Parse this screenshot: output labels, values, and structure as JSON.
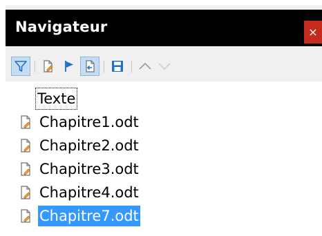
{
  "window": {
    "title": "Navigateur",
    "close_glyph": "×"
  },
  "toolbar": {
    "buttons": [
      {
        "icon": "filter-icon",
        "active": true
      },
      {
        "icon": "edit-document-icon",
        "active": false
      },
      {
        "icon": "flag-icon",
        "active": false
      },
      {
        "icon": "insert-document-icon",
        "active": true
      },
      {
        "icon": "save-icon",
        "active": false
      },
      {
        "icon": "chevron-up-icon",
        "active": false
      },
      {
        "icon": "chevron-down-icon",
        "active": false
      }
    ]
  },
  "tree": {
    "heading": "Texte",
    "items": [
      {
        "label": "Chapitre1.odt",
        "icon": "document-icon"
      },
      {
        "label": "Chapitre2.odt",
        "icon": "document-icon"
      },
      {
        "label": "Chapitre3.odt",
        "icon": "document-icon"
      },
      {
        "label": "Chapitre4.odt",
        "icon": "document-icon"
      },
      {
        "label": "Chapitre7.odt",
        "icon": "document-icon",
        "selected": true
      }
    ]
  },
  "colors": {
    "titlebar": "#000000",
    "close": "#c42b1c",
    "selection": "#3399ff",
    "accent": "#1e6fc8"
  }
}
